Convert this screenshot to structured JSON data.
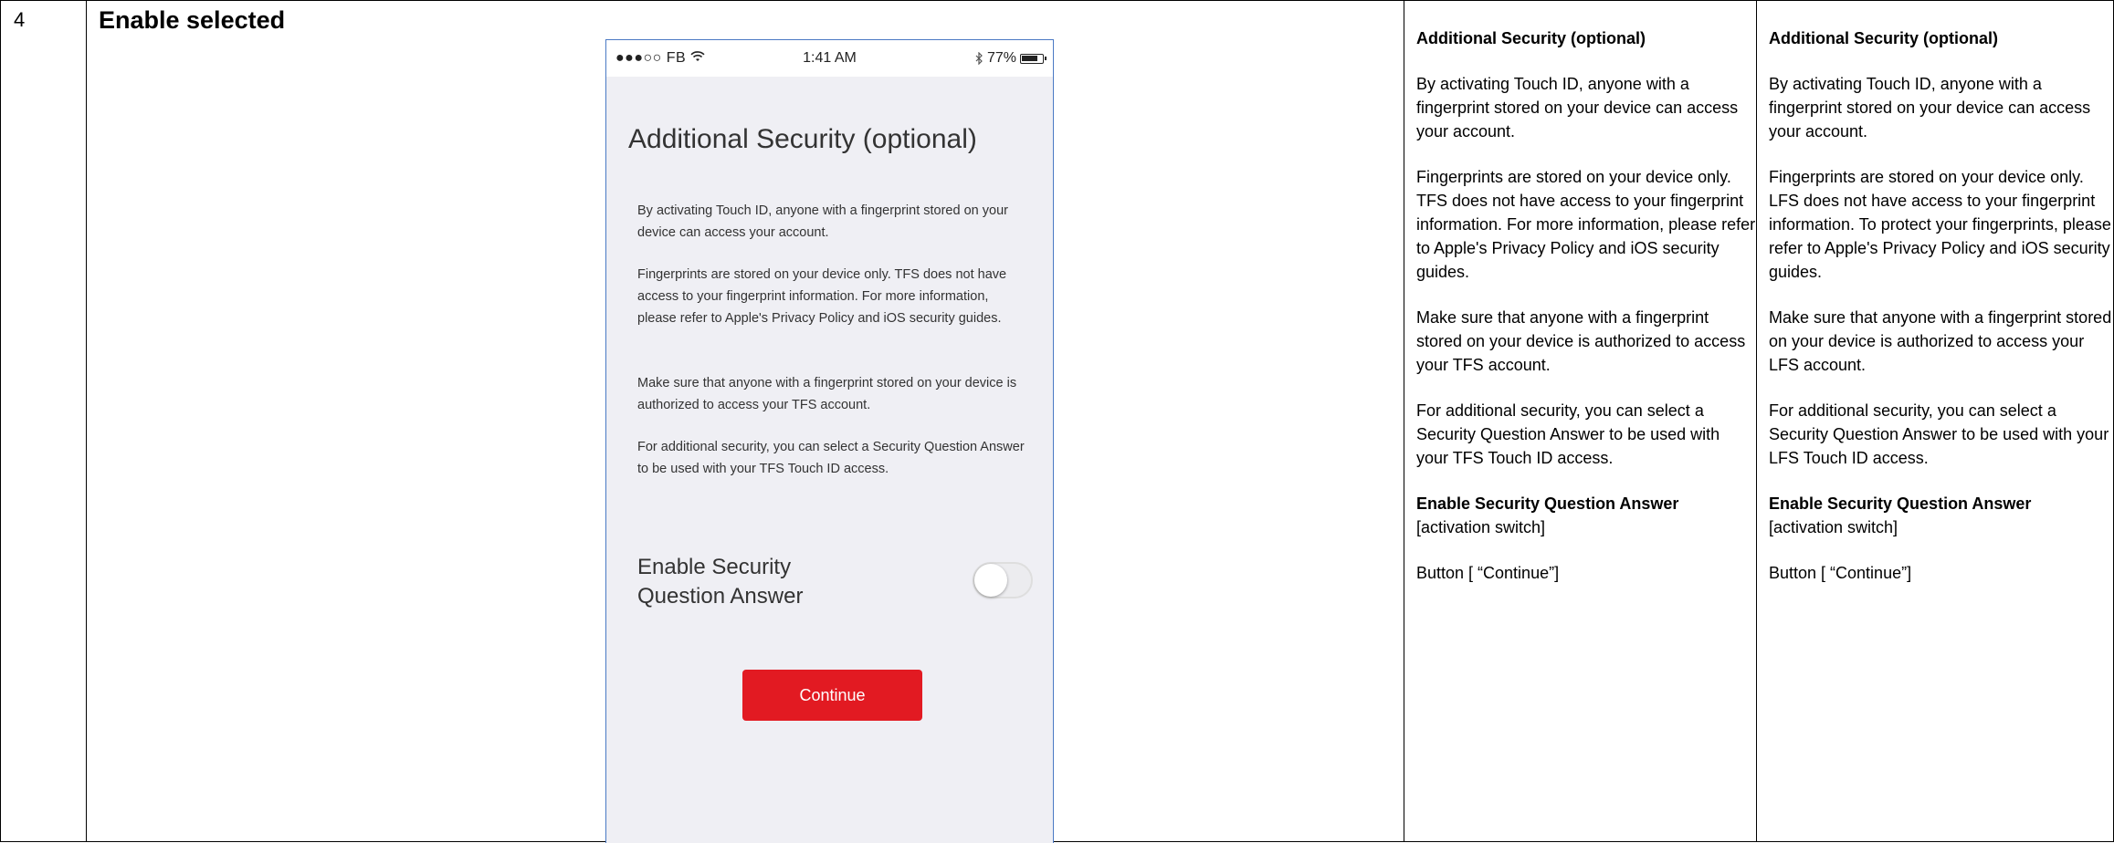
{
  "step": {
    "number": "4",
    "title": "Enable selected"
  },
  "phone": {
    "status_bar": {
      "carrier": "●●●○○ FB",
      "time": "1:41 AM",
      "battery": "77%"
    },
    "title": "Additional Security (optional)",
    "paragraphs": [
      "By activating Touch ID, anyone with a fingerprint stored on your device can access your account.",
      "Fingerprints are stored on your device only. TFS does not have access to your fingerprint information. For more information, please refer to Apple's Privacy Policy and iOS security guides.",
      "Make sure that anyone with a fingerprint stored on your device is authorized to access your TFS account.",
      "For additional security, you can select a Security Question Answer to be used with your TFS Touch ID access."
    ],
    "toggle_label": "Enable Security Question Answer",
    "toggle_on": false,
    "continue_label": "Continue",
    "colors": {
      "button": "#e21a22",
      "background": "#efeff4",
      "frame": "#4a79c4"
    }
  },
  "tfs_text": {
    "heading": "Additional Security (optional)",
    "p1": "By activating Touch ID, anyone with a fingerprint stored on your device can access your account.",
    "p2": "Fingerprints are stored on your device only. TFS does not have access to your fingerprint information. For more information, please refer to Apple's Privacy Policy and iOS security guides.",
    "p3": "Make sure that anyone with a fingerprint stored on your device is authorized to access your TFS account.",
    "p4": "For additional security, you can select a Security Question Answer to be used with your TFS Touch ID access.",
    "toggle_heading": "Enable Security Question Answer",
    "toggle_note": "[activation switch]",
    "button_note": "Button [ “Continue”]"
  },
  "lfs_text": {
    "heading": "Additional Security (optional)",
    "p1": "By activating Touch ID, anyone with a fingerprint stored on your device can access your account.",
    "p2": "Fingerprints are stored on your device only. LFS does not have access to your fingerprint information. To protect your fingerprints, please refer to Apple's Privacy Policy and iOS security guides.",
    "p3": "Make sure that anyone with a fingerprint stored on your device is authorized to access your LFS account.",
    "p4": "For additional security, you can select a Security Question Answer to be used with your LFS Touch ID access.",
    "toggle_heading": "Enable Security Question Answer",
    "toggle_note": "[activation switch]",
    "button_note": "Button [ “Continue”]"
  }
}
